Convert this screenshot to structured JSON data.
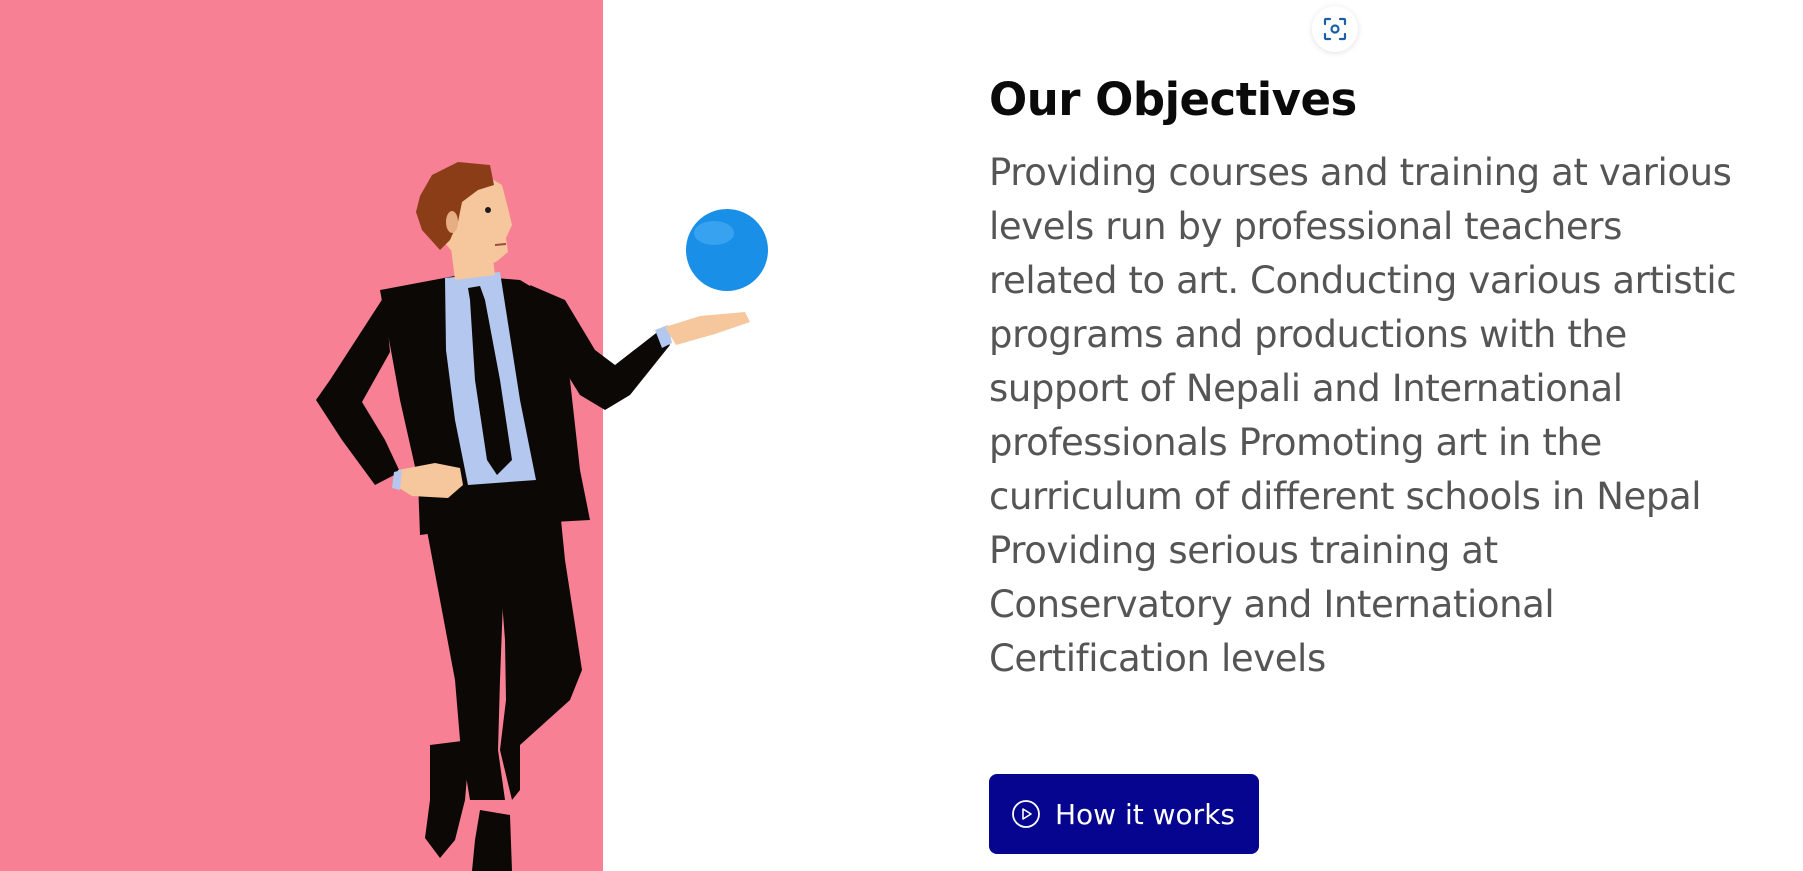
{
  "objectives": {
    "title": "Our Objectives",
    "body": "Providing courses and training at various levels run by professional teachers related to art. Conducting various artistic programs and productions with the support of Nepali and International professionals Promoting art in the curriculum of different schools in Nepal Providing serious training at Conservatory and International Certification levels",
    "cta_label": "How it works",
    "cta_icon": "play-circle-icon"
  },
  "overlay": {
    "scan_icon": "screen-capture-icon"
  },
  "illustration": {
    "subject": "businessman-with-ball-icon",
    "ball_icon": "ball-icon"
  },
  "colors": {
    "pink_panel": "#f78094",
    "button_bg": "#05058f",
    "title": "#0a0a0a",
    "body": "#555555",
    "ball": "#1a8fe8",
    "accent_icon": "#1a5fa8"
  }
}
